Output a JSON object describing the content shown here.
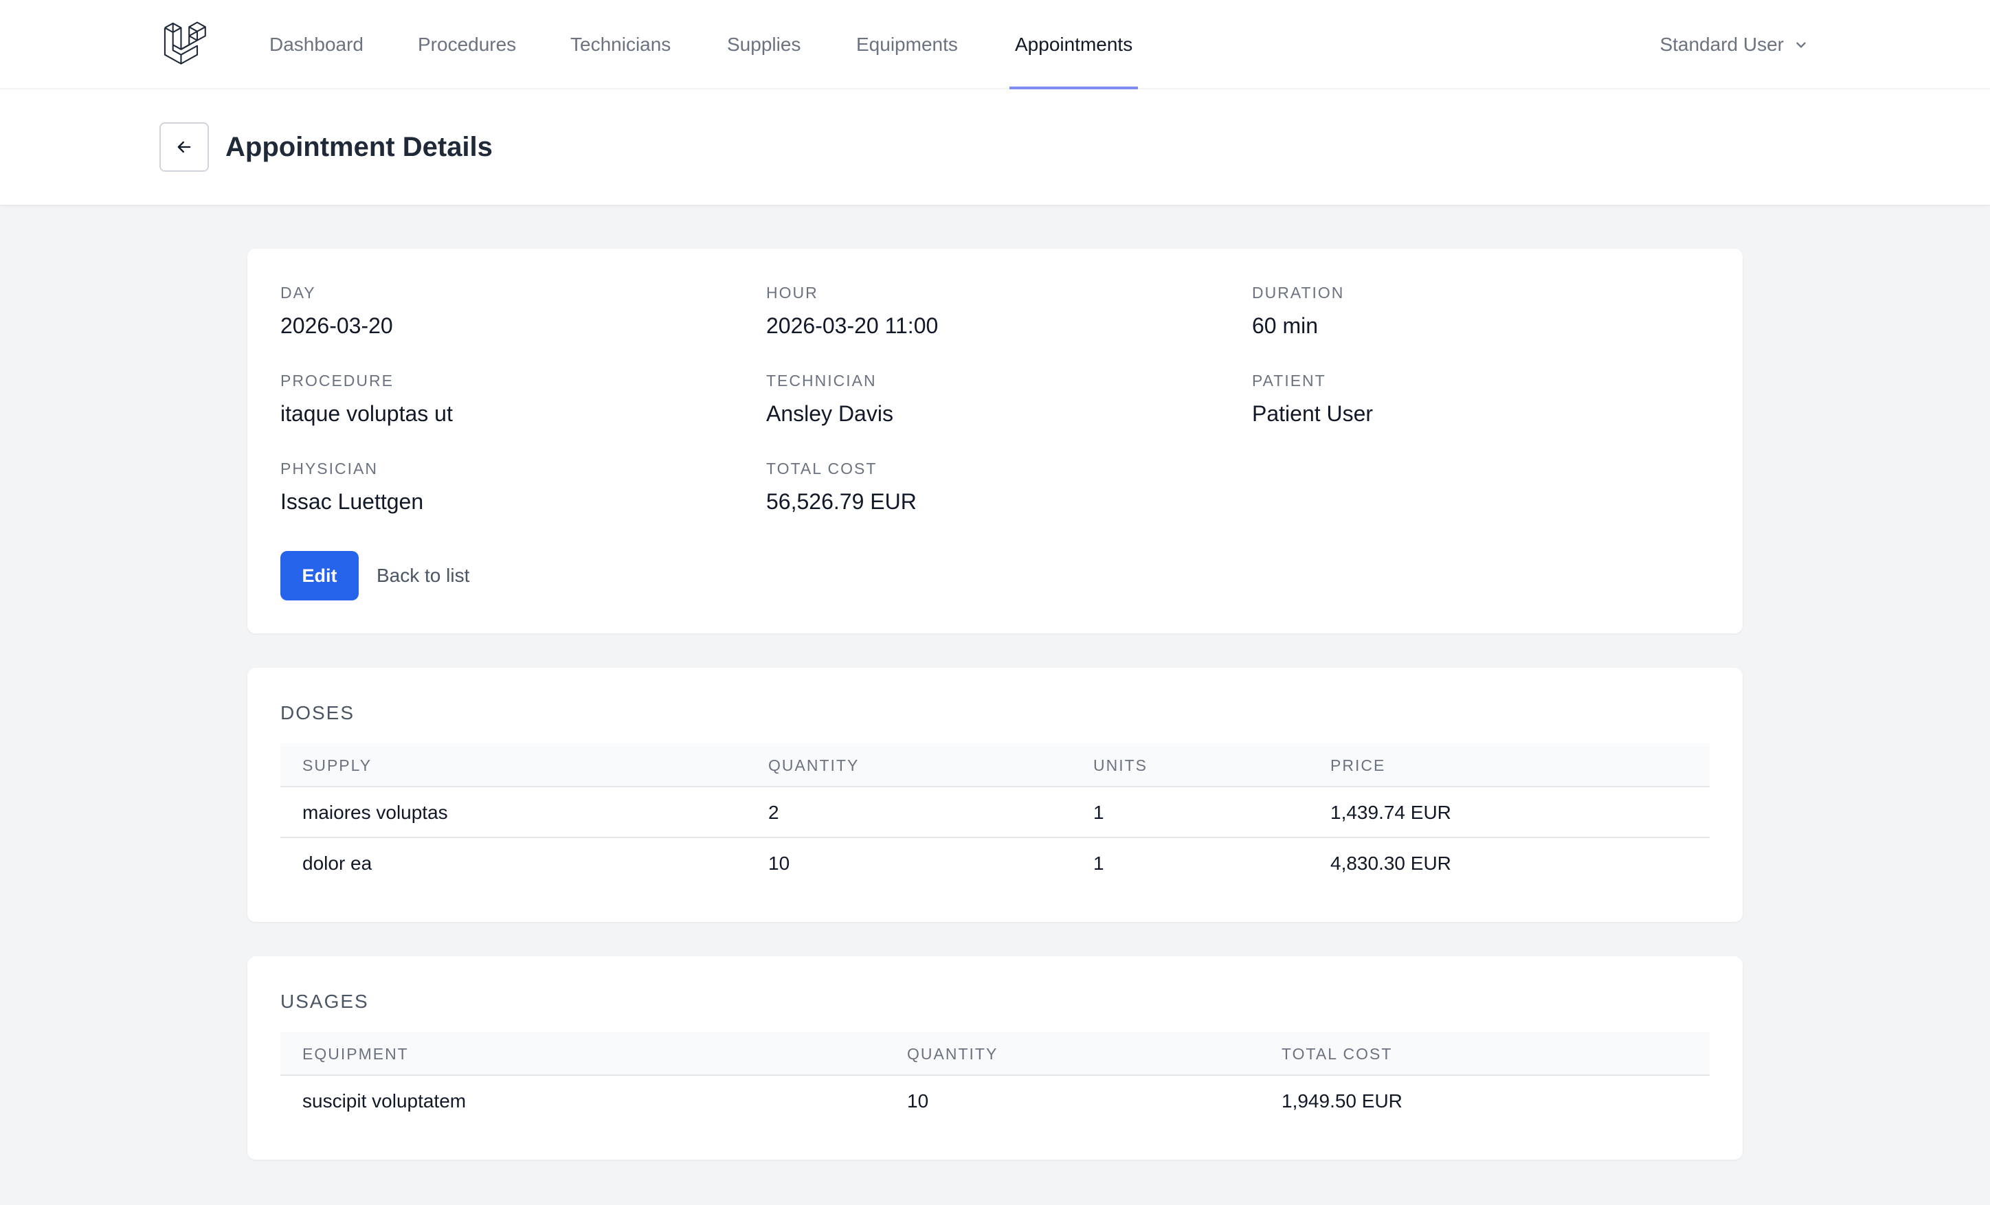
{
  "nav": {
    "items": [
      "Dashboard",
      "Procedures",
      "Technicians",
      "Supplies",
      "Equipments",
      "Appointments"
    ],
    "active": "Appointments",
    "user_name": "Standard User",
    "accent": "#818cf8"
  },
  "header": {
    "title": "Appointment Details"
  },
  "details": {
    "day": {
      "label": "DAY",
      "value": "2026-03-20"
    },
    "hour": {
      "label": "HOUR",
      "value": "2026-03-20 11:00"
    },
    "duration": {
      "label": "DURATION",
      "value": "60 min"
    },
    "procedure": {
      "label": "PROCEDURE",
      "value": "itaque voluptas ut"
    },
    "technician": {
      "label": "TECHNICIAN",
      "value": "Ansley Davis"
    },
    "patient": {
      "label": "PATIENT",
      "value": "Patient User"
    },
    "physician": {
      "label": "PHYSICIAN",
      "value": "Issac Luettgen"
    },
    "total_cost": {
      "label": "TOTAL COST",
      "value": "56,526.79 EUR"
    },
    "edit_label": "Edit",
    "back_label": "Back to list",
    "button_color": "#2563eb"
  },
  "doses": {
    "title": "DOSES",
    "columns": [
      "SUPPLY",
      "QUANTITY",
      "UNITS",
      "PRICE"
    ],
    "rows": [
      [
        "maiores voluptas",
        "2",
        "1",
        "1,439.74 EUR"
      ],
      [
        "dolor ea",
        "10",
        "1",
        "4,830.30 EUR"
      ]
    ]
  },
  "usages": {
    "title": "USAGES",
    "columns": [
      "EQUIPMENT",
      "QUANTITY",
      "TOTAL COST"
    ],
    "rows": [
      [
        "suscipit voluptatem",
        "10",
        "1,949.50 EUR"
      ]
    ]
  }
}
